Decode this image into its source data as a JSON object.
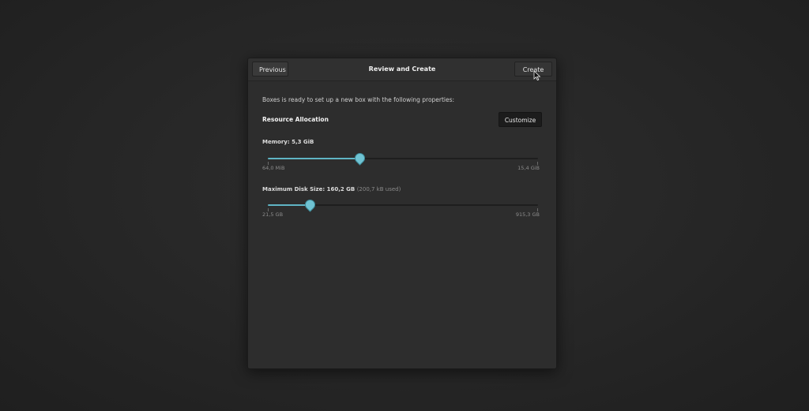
{
  "header": {
    "previous_label": "Previous",
    "title": "Review and Create",
    "create_label": "Create"
  },
  "body": {
    "intro": "Boxes is ready to set up a new box with the following properties:",
    "section_title": "Resource Allocation",
    "customize_label": "Customize"
  },
  "memory": {
    "label": "Memory: 5,3 GiB",
    "min_label": "64,0 MiB",
    "max_label": "15,4 GiB",
    "fraction": 0.34
  },
  "disk": {
    "label": "Maximum Disk Size: 160,2 GB",
    "used_note": "(200,7 kB used)",
    "min_label": "21,5 GB",
    "max_label": "915,3 GB",
    "fraction": 0.155
  },
  "colors": {
    "accent": "#6fc3d3",
    "background": "#262626",
    "dialog": "#2d2d2d"
  }
}
